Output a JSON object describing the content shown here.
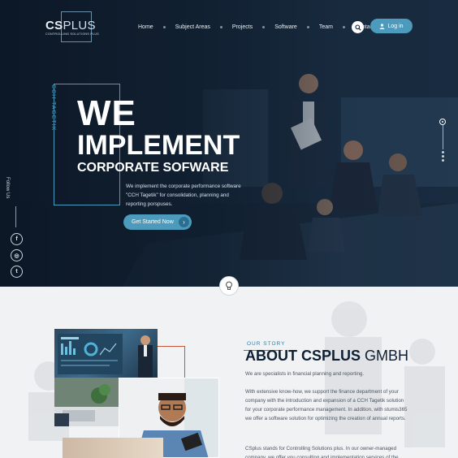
{
  "logo": {
    "word_bold": "CS",
    "word_light": "PLUS",
    "tagline": "CONTROLLING SOLUTIONS PLUS"
  },
  "nav": {
    "items": [
      "Home",
      "Subject Areas",
      "Projects",
      "Software",
      "Team",
      "Contact"
    ],
    "login_label": "Log in"
  },
  "hero": {
    "vertical_tag": "CCH TAGETIK",
    "headline_1": "WE",
    "headline_2": "IMPLEMENT",
    "headline_3": "CORPORATE SOFWARE",
    "description": "We implement the corporate performance software \"CCH Tagetik\" for consolidation, planning and reporting porspuses.",
    "cta_label": "Get Started Now",
    "follow_label": "Follow Us",
    "social": [
      {
        "icon": "facebook-icon",
        "glyph": "f"
      },
      {
        "icon": "instagram-icon",
        "glyph": "◎"
      },
      {
        "icon": "twitter-icon",
        "glyph": "t"
      }
    ]
  },
  "about": {
    "kicker": "OUR STORY",
    "title_bold": "ABOUT CSPLUS",
    "title_light": " GMBH",
    "p1": "We are specialists in financial planning and reporting.",
    "p2": "With extensive know-how, we support the finance department of your company with the introduction and expansion of a CCH Tagetik solution for your  corporate performance management.  In addition, with stumis365 we offer a software solution for optimizing the creation of annual reports.",
    "p3": "CSplus stands for Controlling Solutions plus. In our owner-managed company, we offer you consulting and implementation services of the"
  },
  "colors": {
    "accent": "#4c9bbd",
    "hero_bg": "#14263a",
    "title": "#0f1f33",
    "red_line": "#c4553b"
  }
}
